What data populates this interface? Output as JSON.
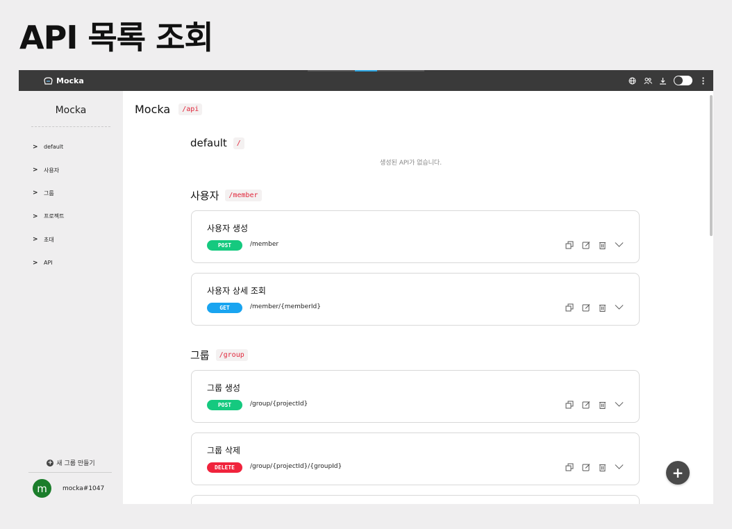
{
  "page_heading": "API 목록 조회",
  "app": {
    "brand": "Mocka",
    "top_icons": [
      "globe-icon",
      "users-icon",
      "download-icon",
      "theme-toggle",
      "more-vertical-icon"
    ]
  },
  "sidebar": {
    "title": "Mocka",
    "items": [
      {
        "label": "default"
      },
      {
        "label": "사용자"
      },
      {
        "label": "그룹"
      },
      {
        "label": "프로젝트"
      },
      {
        "label": "초대"
      },
      {
        "label": "API"
      }
    ],
    "new_group_label": "새 그룹 만들기",
    "user": {
      "avatar_letter": "m",
      "name": "mocka#1047"
    }
  },
  "main": {
    "project_name": "Mocka",
    "project_path": "/api",
    "groups": [
      {
        "name": "default",
        "path": "/",
        "empty_message": "생성된 API가 없습니다."
      },
      {
        "name": "사용자",
        "path": "/member"
      },
      {
        "name": "그룹",
        "path": "/group"
      }
    ],
    "apis": [
      {
        "title": "사용자 생성",
        "method": "POST",
        "path": "/member"
      },
      {
        "title": "사용자 상세 조회",
        "method": "GET",
        "path": "/member/{memberId}"
      },
      {
        "title": "그룹 생성",
        "method": "POST",
        "path": "/group/{projectId}"
      },
      {
        "title": "그룹 삭제",
        "method": "DELETE",
        "path": "/group/{projectId}/{groupId}"
      }
    ],
    "fab_label": "+"
  },
  "colors": {
    "POST": "#15c97f",
    "GET": "#19a4f0",
    "DELETE": "#f0233c",
    "topbar": "#3a3a3a",
    "path_tag": "#e0263a"
  }
}
